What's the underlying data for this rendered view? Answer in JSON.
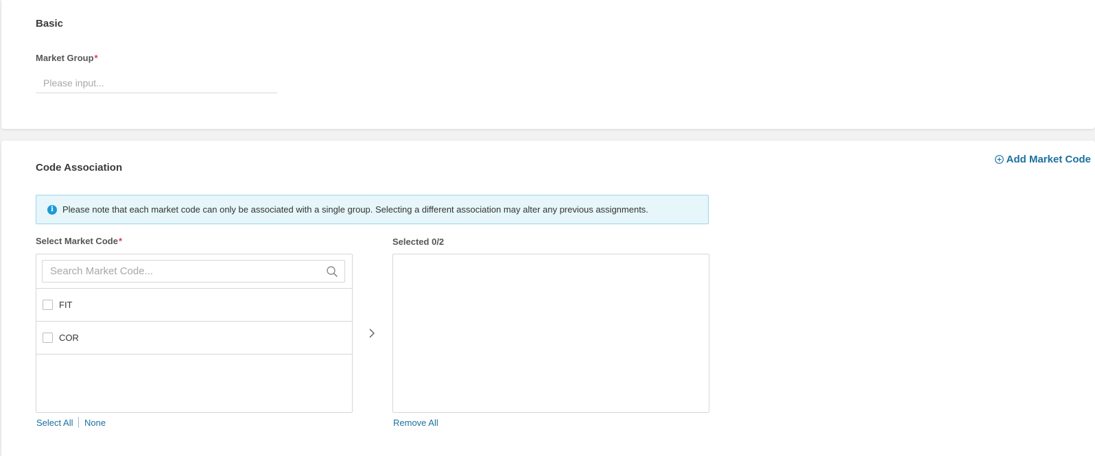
{
  "basic": {
    "title": "Basic",
    "market_group": {
      "label": "Market Group",
      "required_mark": "*",
      "placeholder": "Please input...",
      "value": ""
    }
  },
  "code_association": {
    "title": "Code Association",
    "add_button_label": "Add Market Code",
    "notice": "Please note that each market code can only be associated with a single group. Selecting a different association may alter any previous assignments.",
    "select": {
      "label": "Select Market Code",
      "required_mark": "*",
      "search_placeholder": "Search Market Code...",
      "items": [
        {
          "label": "FIT",
          "checked": false
        },
        {
          "label": "COR",
          "checked": false
        }
      ],
      "select_all_label": "Select All",
      "none_label": "None"
    },
    "selected": {
      "label": "Selected 0/2",
      "remove_all_label": "Remove All"
    }
  },
  "colors": {
    "accent": "#1a6fa0",
    "required": "#e8334a",
    "info": "#1d9ad6",
    "notice_bg": "#e6f6fb",
    "notice_border": "#9ad6ea"
  },
  "icons": {
    "add": "plus-circle-icon",
    "info": "info-icon",
    "search": "search-icon",
    "transfer": "chevron-right-icon"
  }
}
